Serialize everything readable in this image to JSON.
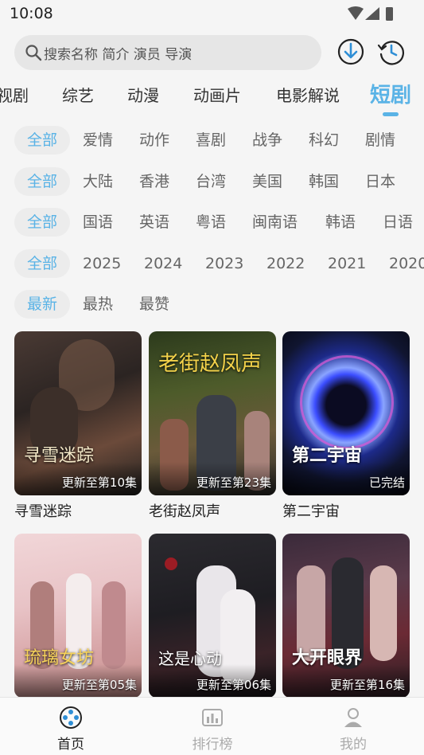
{
  "status_bar": {
    "time": "10:08"
  },
  "search": {
    "placeholder": "搜索名称 简介 演员 导演"
  },
  "icons": {
    "download": "download-icon",
    "history": "history-icon",
    "search": "search-icon"
  },
  "tabs": [
    {
      "label": "视剧"
    },
    {
      "label": "综艺"
    },
    {
      "label": "动漫"
    },
    {
      "label": "动画片"
    },
    {
      "label": "电影解说"
    },
    {
      "label": "短剧"
    }
  ],
  "active_tab": "短剧",
  "filters": {
    "genre": [
      "全部",
      "爱情",
      "动作",
      "喜剧",
      "战争",
      "科幻",
      "剧情"
    ],
    "region": [
      "全部",
      "大陆",
      "香港",
      "台湾",
      "美国",
      "韩国",
      "日本"
    ],
    "language": [
      "全部",
      "国语",
      "英语",
      "粤语",
      "闽南语",
      "韩语",
      "日语"
    ],
    "year": [
      "全部",
      "2025",
      "2024",
      "2023",
      "2022",
      "2021",
      "2020"
    ],
    "sort": [
      "最新",
      "最热",
      "最赞"
    ]
  },
  "videos": [
    {
      "title": "寻雪迷踪",
      "status": "更新至第10集",
      "poster_text": "寻雪迷踪"
    },
    {
      "title": "老街赵凤声",
      "status": "更新至第23集",
      "poster_text": "老街赵凤声"
    },
    {
      "title": "第二宇宙",
      "status": "已完结",
      "poster_text": "第二宇宙"
    },
    {
      "title": "琉璃女坊",
      "status": "更新至第05集",
      "poster_text": "琉璃女坊"
    },
    {
      "title": "这是心动的感觉",
      "status": "更新至第06集",
      "poster_text": "这是心动"
    },
    {
      "title": "大开眼界",
      "status": "更新至第16集",
      "poster_text": "大开眼界"
    }
  ],
  "bottom_nav": [
    {
      "label": "首页",
      "active": true
    },
    {
      "label": "排行榜",
      "active": false
    },
    {
      "label": "我的",
      "active": false
    }
  ],
  "colors": {
    "accent": "#5ab3e6",
    "background": "#f5f5f5"
  }
}
